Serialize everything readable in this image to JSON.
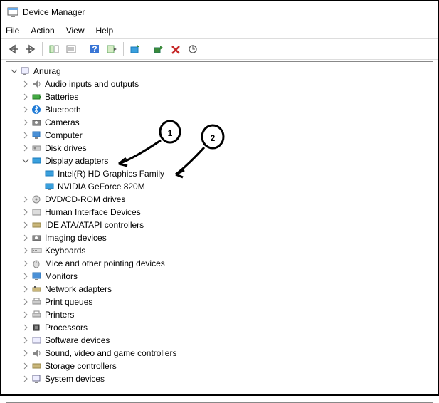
{
  "window": {
    "title": "Device Manager"
  },
  "menu": {
    "file": "File",
    "action": "Action",
    "view": "View",
    "help": "Help"
  },
  "tree": {
    "root": "Anurag",
    "items": [
      {
        "label": "Audio inputs and outputs",
        "expanded": false
      },
      {
        "label": "Batteries",
        "expanded": false
      },
      {
        "label": "Bluetooth",
        "expanded": false
      },
      {
        "label": "Cameras",
        "expanded": false
      },
      {
        "label": "Computer",
        "expanded": false
      },
      {
        "label": "Disk drives",
        "expanded": false
      },
      {
        "label": "Display adapters",
        "expanded": true,
        "children": [
          {
            "label": "Intel(R) HD Graphics Family"
          },
          {
            "label": "NVIDIA GeForce 820M"
          }
        ]
      },
      {
        "label": "DVD/CD-ROM drives",
        "expanded": false
      },
      {
        "label": "Human Interface Devices",
        "expanded": false
      },
      {
        "label": "IDE ATA/ATAPI controllers",
        "expanded": false
      },
      {
        "label": "Imaging devices",
        "expanded": false
      },
      {
        "label": "Keyboards",
        "expanded": false
      },
      {
        "label": "Mice and other pointing devices",
        "expanded": false
      },
      {
        "label": "Monitors",
        "expanded": false
      },
      {
        "label": "Network adapters",
        "expanded": false
      },
      {
        "label": "Print queues",
        "expanded": false
      },
      {
        "label": "Printers",
        "expanded": false
      },
      {
        "label": "Processors",
        "expanded": false
      },
      {
        "label": "Software devices",
        "expanded": false
      },
      {
        "label": "Sound, video and game controllers",
        "expanded": false
      },
      {
        "label": "Storage controllers",
        "expanded": false
      },
      {
        "label": "System devices",
        "expanded": false
      }
    ]
  },
  "annotations": {
    "mark1": "1",
    "mark2": "2"
  }
}
